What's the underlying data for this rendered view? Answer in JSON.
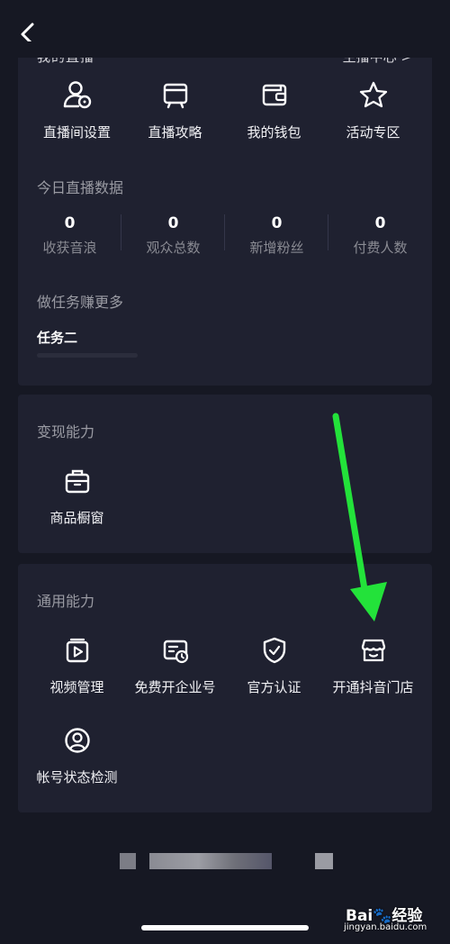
{
  "header": {
    "back_label": "<"
  },
  "top_section": {
    "title": "我的直播",
    "link": "主播中心 >"
  },
  "live_tools": [
    {
      "label": "直播间设置",
      "icon": "user-settings-icon"
    },
    {
      "label": "直播攻略",
      "icon": "tv-icon"
    },
    {
      "label": "我的钱包",
      "icon": "wallet-icon"
    },
    {
      "label": "活动专区",
      "icon": "star-icon"
    }
  ],
  "today_data": {
    "title": "今日直播数据",
    "stats": [
      {
        "value": "0",
        "label": "收获音浪"
      },
      {
        "value": "0",
        "label": "观众总数"
      },
      {
        "value": "0",
        "label": "新增粉丝"
      },
      {
        "value": "0",
        "label": "付费人数"
      }
    ]
  },
  "tasks": {
    "title": "做任务赚更多",
    "task_name": "任务二"
  },
  "monetize": {
    "title": "变现能力",
    "items": [
      {
        "label": "商品橱窗",
        "icon": "briefcase-icon"
      }
    ]
  },
  "general": {
    "title": "通用能力",
    "items": [
      {
        "label": "视频管理",
        "icon": "video-icon"
      },
      {
        "label": "免费开企业号",
        "icon": "enterprise-icon"
      },
      {
        "label": "官方认证",
        "icon": "shield-check-icon"
      },
      {
        "label": "开通抖音门店",
        "icon": "store-icon"
      },
      {
        "label": "帐号状态检测",
        "icon": "account-check-icon"
      }
    ]
  },
  "watermark": {
    "logo": "Bai🐾经验",
    "site": "jingyan.baidu.com"
  },
  "colors": {
    "background": "#161823",
    "card": "#1f2130",
    "arrow": "#23e23a",
    "muted": "#8a8b93"
  }
}
